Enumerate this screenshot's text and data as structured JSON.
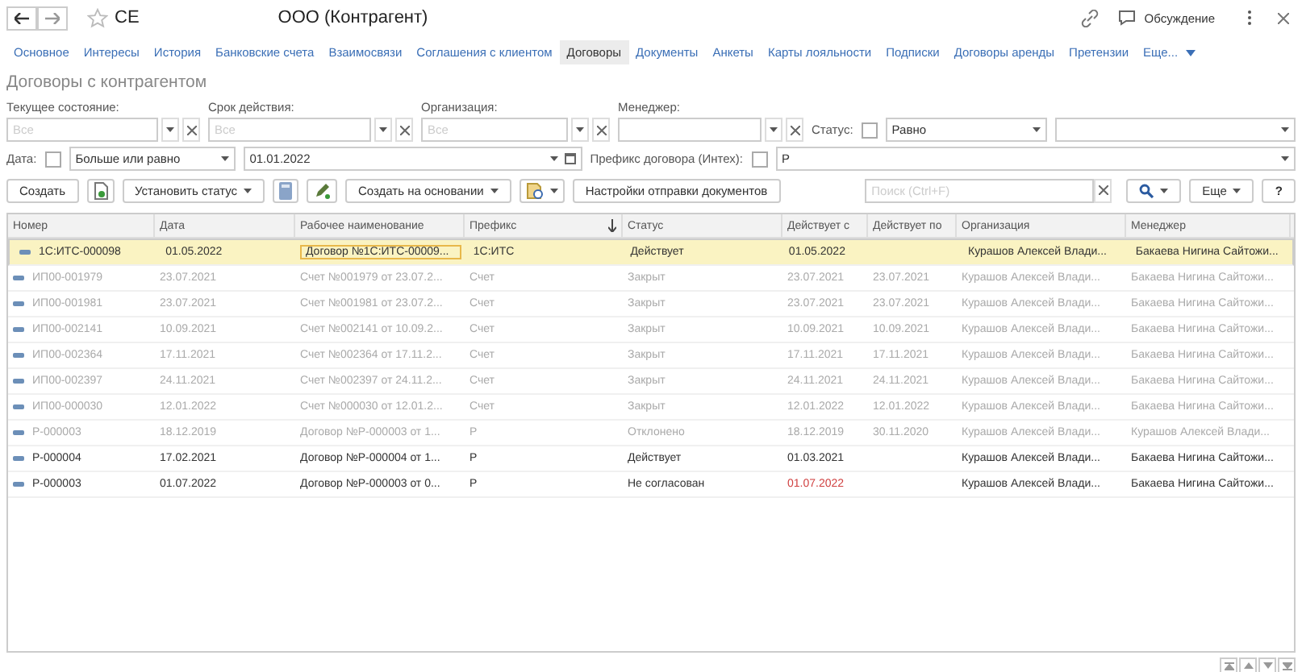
{
  "header": {
    "title": "СЕ",
    "subtitle": "ООО (Контрагент)",
    "favorite": false,
    "discussion": "Обсуждение"
  },
  "tabs": [
    {
      "label": "Основное",
      "selected": false
    },
    {
      "label": "Интересы",
      "selected": false
    },
    {
      "label": "История",
      "selected": false
    },
    {
      "label": "Банковские счета",
      "selected": false
    },
    {
      "label": "Взаимосвязи",
      "selected": false
    },
    {
      "label": "Соглашения с клиентом",
      "selected": false
    },
    {
      "label": "Договоры",
      "selected": true
    },
    {
      "label": "Документы",
      "selected": false
    },
    {
      "label": "Анкеты",
      "selected": false
    },
    {
      "label": "Карты лояльности",
      "selected": false
    },
    {
      "label": "Подписки",
      "selected": false
    },
    {
      "label": "Договоры аренды",
      "selected": false
    },
    {
      "label": "Претензии",
      "selected": false
    },
    {
      "label": "Еще...",
      "selected": false
    }
  ],
  "heading": "Договоры с контрагентом",
  "filters": [
    {
      "label": "Текущее состояние:",
      "placeholder": "Все"
    },
    {
      "label": "Срок действия:",
      "placeholder": "Все"
    },
    {
      "label": "Организация:",
      "placeholder": "Все"
    },
    {
      "label": "Менеджер:"
    }
  ],
  "status_filter": {
    "label": "Статус:",
    "checked": false,
    "operator": "Равно"
  },
  "date_filter": {
    "label": "Дата:",
    "checked": false,
    "operator": "Больше или равно",
    "value": "01.01.2022"
  },
  "prefix_filter": {
    "label": "Префикс договора (Интех):",
    "checked": false,
    "value": "Р"
  },
  "toolbar": {
    "create": "Создать",
    "set_status": "Установить статус",
    "create_based": "Создать на основании",
    "send_settings": "Настройки отправки документов",
    "search_placeholder": "Поиск (Ctrl+F)",
    "more": "Еще",
    "help": "?"
  },
  "table": {
    "columns": [
      {
        "title": "Номер",
        "sorted": false
      },
      {
        "title": "Дата",
        "sorted": false
      },
      {
        "title": "Рабочее наименование",
        "sorted": false
      },
      {
        "title": "Префикс",
        "sorted": true
      },
      {
        "title": "Статус",
        "sorted": false
      },
      {
        "title": "Действует с",
        "sorted": false
      },
      {
        "title": "Действует по",
        "sorted": false
      },
      {
        "title": "Организация",
        "sorted": false
      },
      {
        "title": "Менеджер",
        "sorted": false
      }
    ],
    "rows": [
      {
        "cells": [
          "1С:ИТС-000098",
          "01.05.2022",
          "Договор №1С:ИТС-00009...",
          "1С:ИТС",
          "Действует",
          "01.05.2022",
          "",
          "Курашов Алексей Влади...",
          "Бакаева Нигина Сайтожи..."
        ],
        "selected": true,
        "dimmed": false,
        "overdue": false
      },
      {
        "cells": [
          "ИП00-001979",
          "23.07.2021",
          "Счет №001979 от 23.07.2...",
          "Счет",
          "Закрыт",
          "23.07.2021",
          "23.07.2021",
          "Курашов Алексей Влади...",
          "Бакаева Нигина Сайтожи..."
        ],
        "selected": false,
        "dimmed": true,
        "overdue": false
      },
      {
        "cells": [
          "ИП00-001981",
          "23.07.2021",
          "Счет №001981 от 23.07.2...",
          "Счет",
          "Закрыт",
          "23.07.2021",
          "23.07.2021",
          "Курашов Алексей Влади...",
          "Бакаева Нигина Сайтожи..."
        ],
        "selected": false,
        "dimmed": true,
        "overdue": false
      },
      {
        "cells": [
          "ИП00-002141",
          "10.09.2021",
          "Счет №002141 от 10.09.2...",
          "Счет",
          "Закрыт",
          "10.09.2021",
          "10.09.2021",
          "Курашов Алексей Влади...",
          "Бакаева Нигина Сайтожи..."
        ],
        "selected": false,
        "dimmed": true,
        "overdue": false
      },
      {
        "cells": [
          "ИП00-002364",
          "17.11.2021",
          "Счет №002364 от 17.11.2...",
          "Счет",
          "Закрыт",
          "17.11.2021",
          "17.11.2021",
          "Курашов Алексей Влади...",
          "Бакаева Нигина Сайтожи..."
        ],
        "selected": false,
        "dimmed": true,
        "overdue": false
      },
      {
        "cells": [
          "ИП00-002397",
          "24.11.2021",
          "Счет №002397 от 24.11.2...",
          "Счет",
          "Закрыт",
          "24.11.2021",
          "24.11.2021",
          "Курашов Алексей Влади...",
          "Бакаева Нигина Сайтожи..."
        ],
        "selected": false,
        "dimmed": true,
        "overdue": false
      },
      {
        "cells": [
          "ИП00-000030",
          "12.01.2022",
          "Счет №000030 от 12.01.2...",
          "Счет",
          "Закрыт",
          "12.01.2022",
          "12.01.2022",
          "Курашов Алексей Влади...",
          "Бакаева Нигина Сайтожи..."
        ],
        "selected": false,
        "dimmed": true,
        "overdue": false
      },
      {
        "cells": [
          "Р-000003",
          "18.12.2019",
          "Договор №Р-000003 от 1...",
          "Р",
          "Отклонено",
          "18.12.2019",
          "30.11.2020",
          "Курашов Алексей Влади...",
          "Курашов Алексей Влади..."
        ],
        "selected": false,
        "dimmed": true,
        "overdue": false
      },
      {
        "cells": [
          "Р-000004",
          "17.02.2021",
          "Договор №Р-000004 от 1...",
          "Р",
          "Действует",
          "01.03.2021",
          "",
          "Курашов Алексей Влади...",
          "Бакаева Нигина Сайтожи..."
        ],
        "selected": false,
        "dimmed": false,
        "overdue": false
      },
      {
        "cells": [
          "Р-000003",
          "01.07.2022",
          "Договор №Р-000003 от 0...",
          "Р",
          "Не согласован",
          "01.07.2022",
          "",
          "Курашов Алексей Влади...",
          "Бакаева Нигина Сайтожи..."
        ],
        "selected": false,
        "dimmed": false,
        "overdue": true
      }
    ]
  }
}
